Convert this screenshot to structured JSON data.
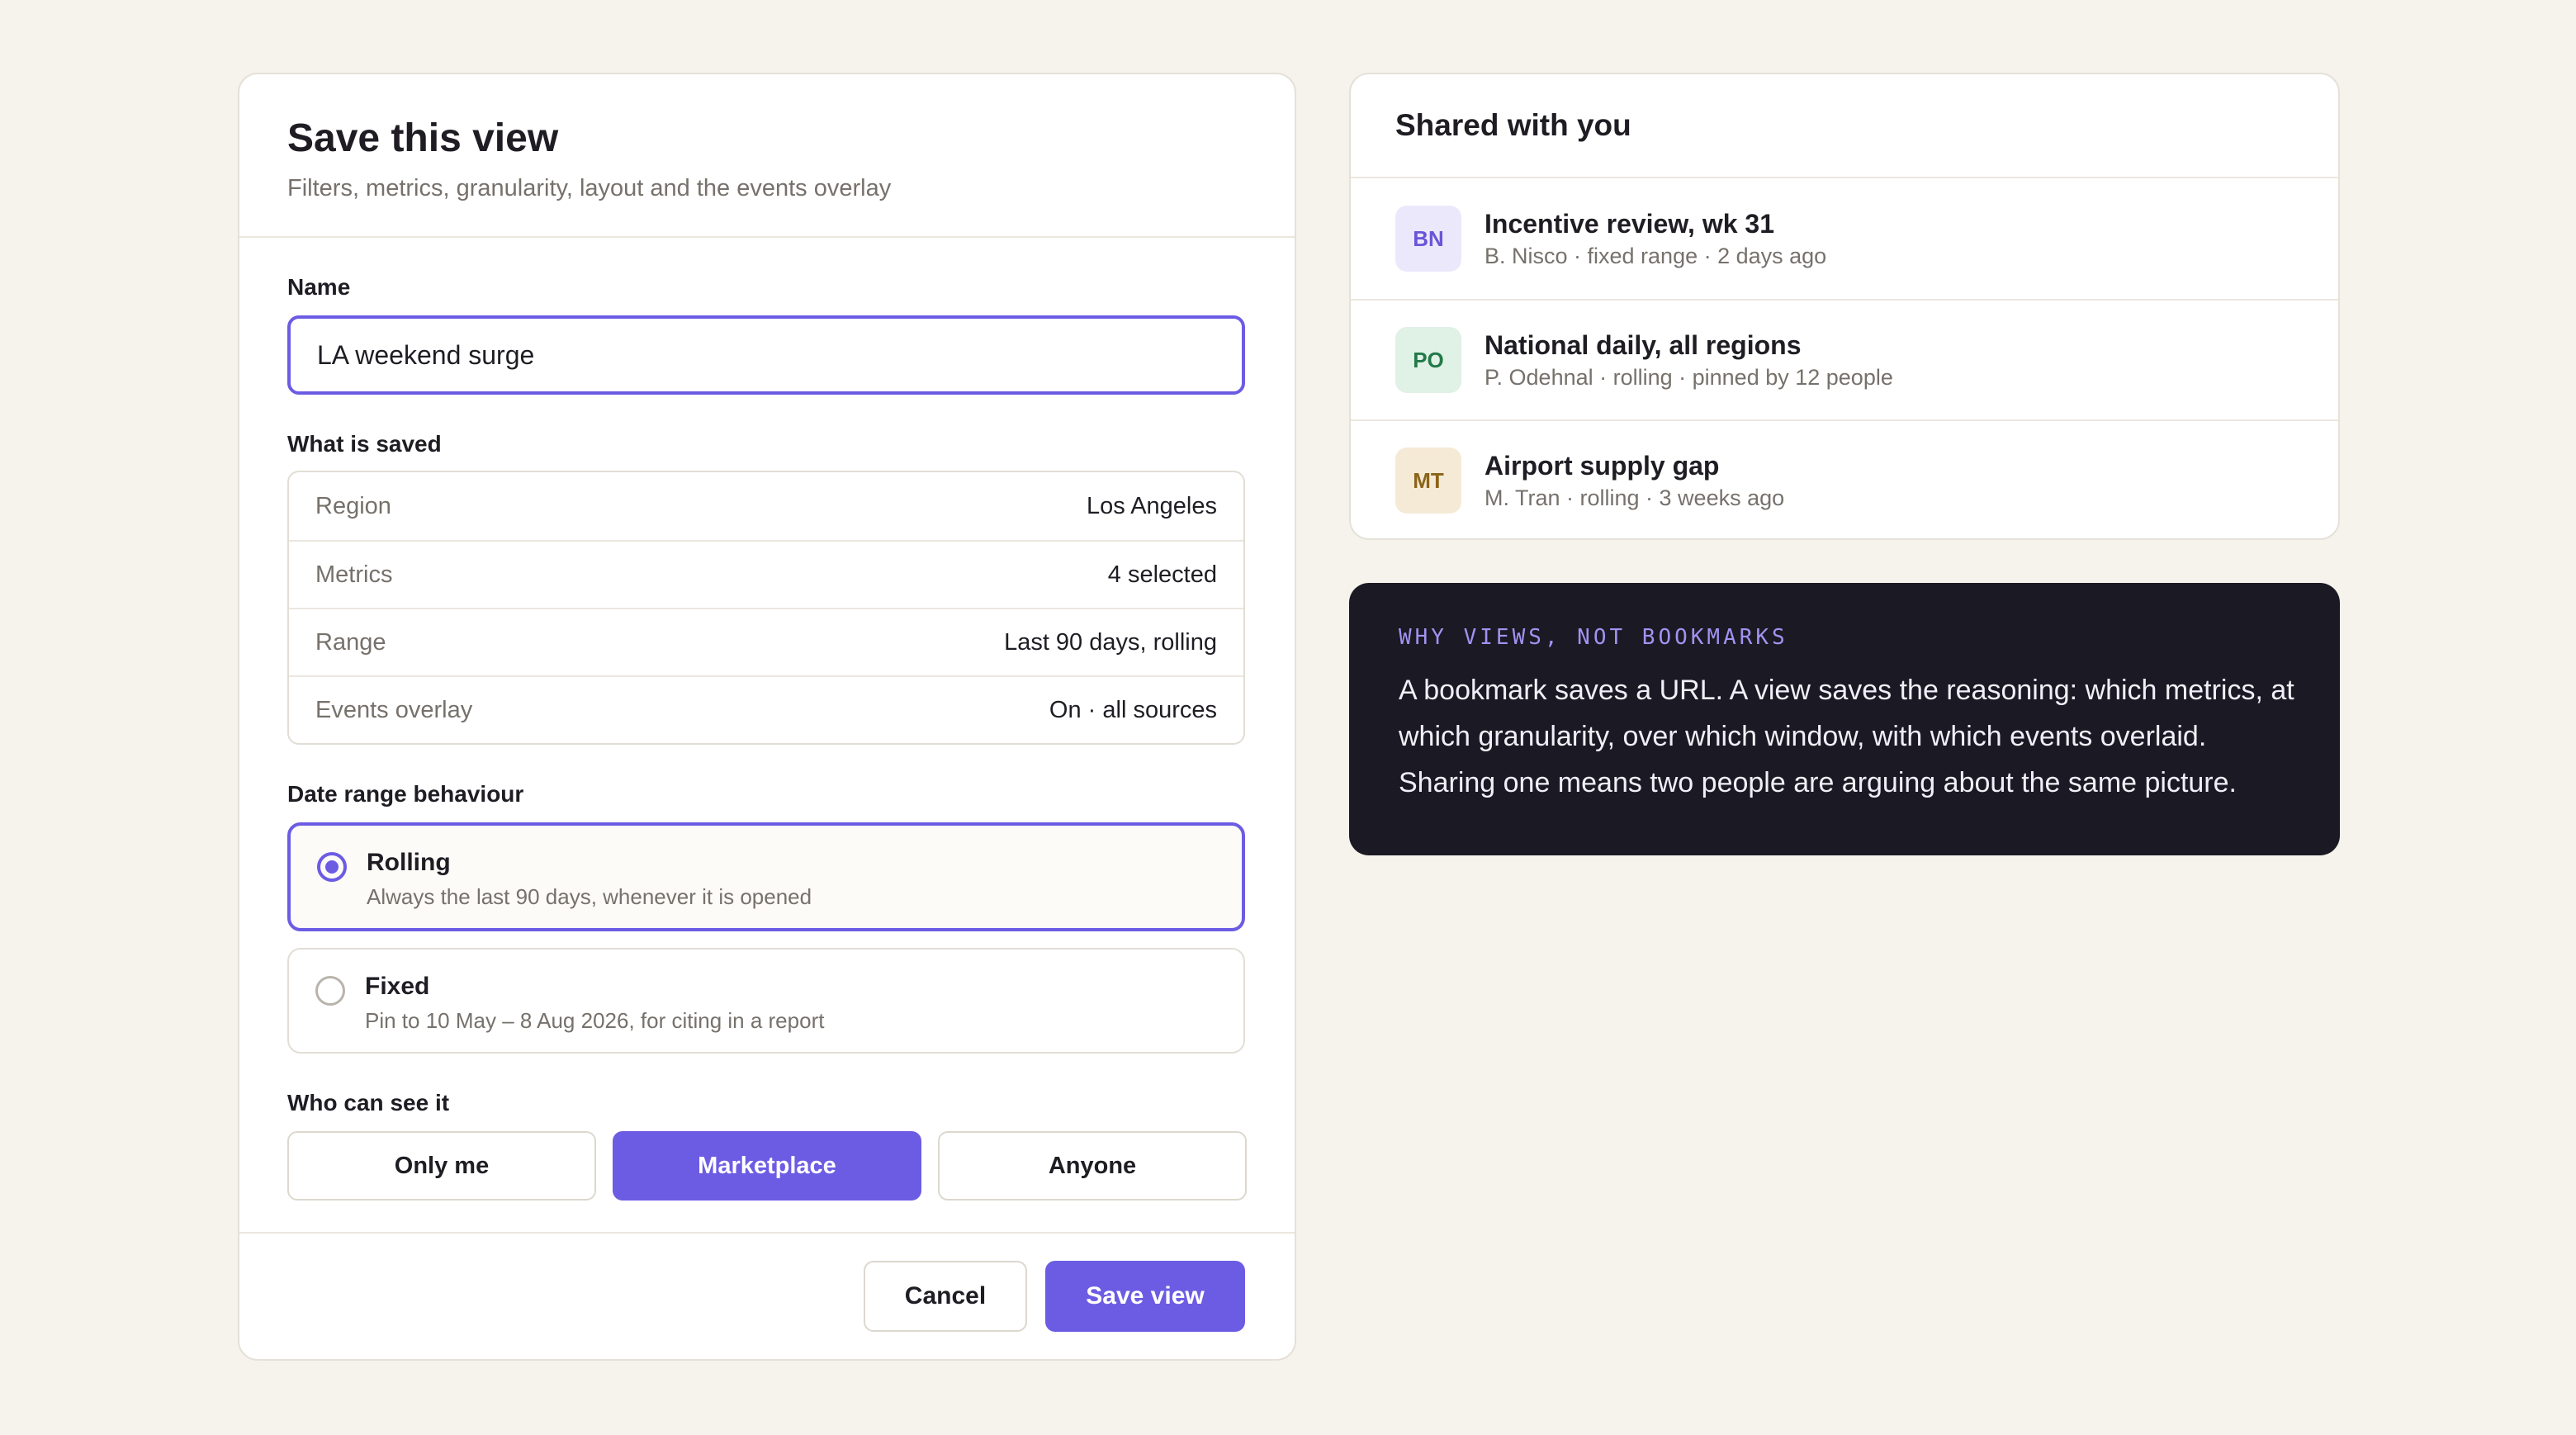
{
  "dialog": {
    "title": "Save this view",
    "subtitle": "Filters, metrics, granularity, layout and the events overlay",
    "name_label": "Name",
    "name_value": "LA weekend surge",
    "saved_label": "What is saved",
    "saved_rows": [
      {
        "key": "Region",
        "value": "Los Angeles"
      },
      {
        "key": "Metrics",
        "value": "4 selected"
      },
      {
        "key": "Range",
        "value": "Last 90 days, rolling"
      },
      {
        "key": "Events overlay",
        "value": "On · all sources"
      }
    ],
    "range_label": "Date range behaviour",
    "range_options": [
      {
        "title": "Rolling",
        "desc": "Always the last 90 days, whenever it is opened",
        "selected": true
      },
      {
        "title": "Fixed",
        "desc": "Pin to 10 May – 8 Aug 2026, for citing in a report",
        "selected": false
      }
    ],
    "visibility_label": "Who can see it",
    "visibility_options": [
      "Only me",
      "Marketplace",
      "Anyone"
    ],
    "visibility_selected": "Marketplace",
    "cancel_label": "Cancel",
    "save_label": "Save view"
  },
  "shared": {
    "title": "Shared with you",
    "items": [
      {
        "initials": "BN",
        "title": "Incentive review, wk 31",
        "meta": "B. Nisco · fixed range · 2 days ago",
        "avatar_bg": "#ece8fc",
        "avatar_fg": "#6a55d8"
      },
      {
        "initials": "PO",
        "title": "National daily, all regions",
        "meta": "P. Odehnal · rolling · pinned by 12 people",
        "avatar_bg": "#e0f1e6",
        "avatar_fg": "#227a48"
      },
      {
        "initials": "MT",
        "title": "Airport supply gap",
        "meta": "M. Tran · rolling · 3 weeks ago",
        "avatar_bg": "#f5ead6",
        "avatar_fg": "#8a6418"
      }
    ]
  },
  "note": {
    "eyebrow": "WHY VIEWS, NOT BOOKMARKS",
    "body": "A bookmark saves a URL. A view saves the reasoning: which metrics, at which granularity, over which window, with which events overlaid. Sharing one means two people are arguing about the same picture."
  },
  "colors": {
    "accent": "#6c5ce3",
    "background": "#f6f3ec",
    "note_bg": "#1b1923"
  }
}
